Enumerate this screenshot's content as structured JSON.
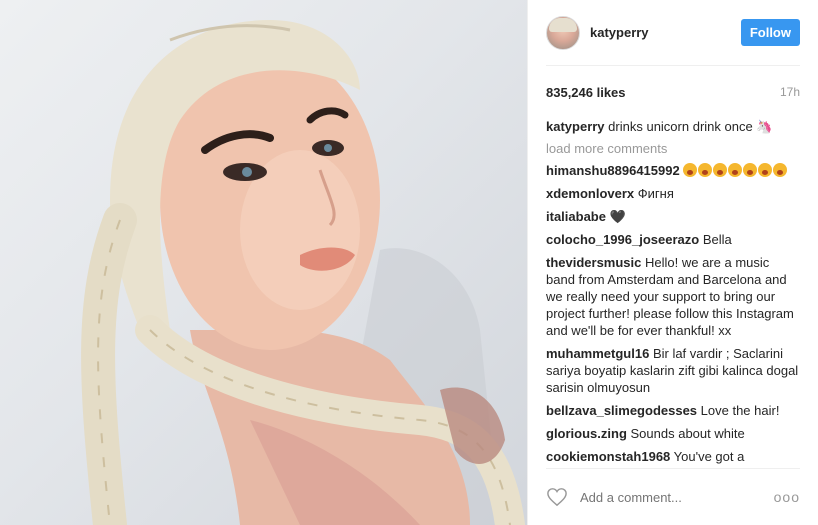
{
  "header": {
    "username": "katyperry",
    "follow_label": "Follow"
  },
  "post": {
    "likes": "835,246 likes",
    "time": "17h",
    "caption_user": "katyperry",
    "caption_text": "drinks unicorn drink once 🦄",
    "load_more": "load more comments"
  },
  "comments": [
    {
      "user": "himanshu8896415992",
      "text": ""
    },
    {
      "user": "xdemonloverx",
      "text": "Фигня"
    },
    {
      "user": "italiababe",
      "text": "🖤"
    },
    {
      "user": "colocho_1996_joseerazo",
      "text": "Bella"
    },
    {
      "user": "thevidersmusic",
      "text": "Hello! we are a music band from Amsterdam and Barcelona and we really need your support to bring our project further! please follow this Instagram and we'll be for ever thankful! xx"
    },
    {
      "user": "muhammetgul16",
      "text": "Bir laf vardir ; Saclarini sariya boyatip kaslarin zift gibi kalinca dogal sarisin olmuyosun"
    },
    {
      "user": "bellzava_slimegodesses",
      "text": "Love the hair!"
    },
    {
      "user": "glorious.zing",
      "text": "Sounds about white"
    },
    {
      "user": "cookiemonstah1968",
      "text": "You've got a"
    }
  ],
  "footer": {
    "add_comment_placeholder": "Add a comment...",
    "more_label": "ooo"
  },
  "colors": {
    "follow_button": "#3897f0",
    "muted_text": "#999999"
  },
  "icons": {
    "like": "heart-outline-icon",
    "more": "more-options-icon"
  }
}
